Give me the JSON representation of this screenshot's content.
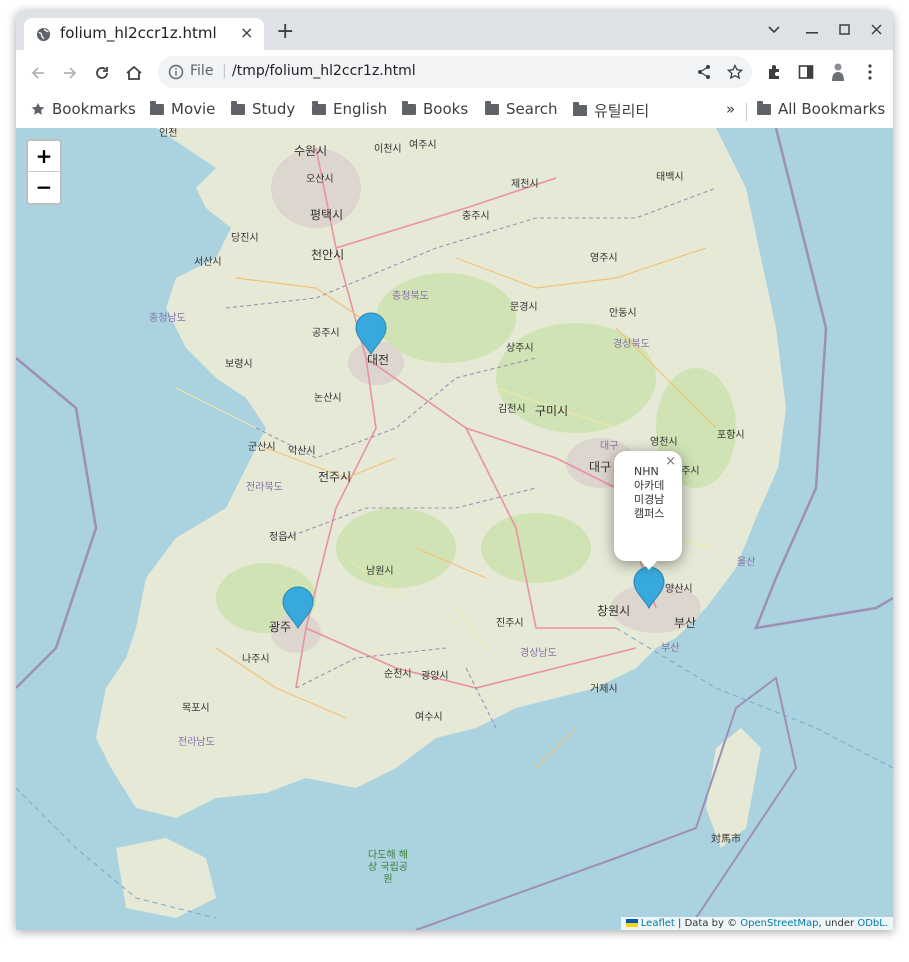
{
  "tab": {
    "title": "folium_hl2ccr1z.html",
    "close": "×"
  },
  "new_tab": "+",
  "omnibox": {
    "scheme": "File",
    "separator": "|",
    "url": "/tmp/folium_hl2ccr1z.html"
  },
  "bookmarks": {
    "items": [
      "Bookmarks",
      "Movie",
      "Study",
      "English",
      "Books",
      "Search",
      "유틸리티"
    ],
    "overflow": "»",
    "all": "All Bookmarks"
  },
  "map": {
    "zoom_in": "+",
    "zoom_out": "−",
    "labels": [
      {
        "t": "인천",
        "c": ""
      },
      {
        "t": "수원시",
        "c": "big"
      },
      {
        "t": "이천시",
        "c": ""
      },
      {
        "t": "여주시",
        "c": ""
      },
      {
        "t": "오산시",
        "c": ""
      },
      {
        "t": "제천시",
        "c": ""
      },
      {
        "t": "태백시",
        "c": ""
      },
      {
        "t": "평택시",
        "c": "big"
      },
      {
        "t": "충주시",
        "c": ""
      },
      {
        "t": "당진시",
        "c": ""
      },
      {
        "t": "천안시",
        "c": "big"
      },
      {
        "t": "서산시",
        "c": ""
      },
      {
        "t": "영주시",
        "c": ""
      },
      {
        "t": "충청북도",
        "c": "prov"
      },
      {
        "t": "문경시",
        "c": ""
      },
      {
        "t": "충청남도",
        "c": "prov"
      },
      {
        "t": "공주시",
        "c": ""
      },
      {
        "t": "안동시",
        "c": ""
      },
      {
        "t": "대전",
        "c": "big"
      },
      {
        "t": "보령시",
        "c": ""
      },
      {
        "t": "상주시",
        "c": ""
      },
      {
        "t": "경상북도",
        "c": "prov"
      },
      {
        "t": "논산시",
        "c": ""
      },
      {
        "t": "김천시",
        "c": ""
      },
      {
        "t": "구미시",
        "c": "big"
      },
      {
        "t": "포항시",
        "c": ""
      },
      {
        "t": "군산시",
        "c": ""
      },
      {
        "t": "익산시",
        "c": ""
      },
      {
        "t": "대구",
        "c": "prov"
      },
      {
        "t": "영천시",
        "c": ""
      },
      {
        "t": "대구",
        "c": "big"
      },
      {
        "t": "전주시",
        "c": "big"
      },
      {
        "t": "경주시",
        "c": ""
      },
      {
        "t": "전라북도",
        "c": "prov"
      },
      {
        "t": "정읍시",
        "c": ""
      },
      {
        "t": "울산",
        "c": "prov"
      },
      {
        "t": "남원시",
        "c": ""
      },
      {
        "t": "양산시",
        "c": ""
      },
      {
        "t": "창원시",
        "c": "big"
      },
      {
        "t": "부산",
        "c": "big"
      },
      {
        "t": "진주시",
        "c": ""
      },
      {
        "t": "광주",
        "c": "big"
      },
      {
        "t": "나주시",
        "c": ""
      },
      {
        "t": "부산",
        "c": "prov"
      },
      {
        "t": "경상남도",
        "c": "prov"
      },
      {
        "t": "순천시",
        "c": ""
      },
      {
        "t": "광양시",
        "c": ""
      },
      {
        "t": "거제시",
        "c": ""
      },
      {
        "t": "목포시",
        "c": ""
      },
      {
        "t": "여수시",
        "c": ""
      },
      {
        "t": "전라남도",
        "c": "prov"
      },
      {
        "t": "対馬市",
        "c": ""
      }
    ],
    "park_label": "다도해 해상 국립공원"
  },
  "popup": {
    "text": "NHN아카데미경남캠퍼스",
    "close": "×"
  },
  "attribution": {
    "leaflet": "Leaflet",
    "sep": "| Data by ©",
    "osm": "OpenStreetMap",
    "under": ", under",
    "odbl": "ODbL."
  }
}
